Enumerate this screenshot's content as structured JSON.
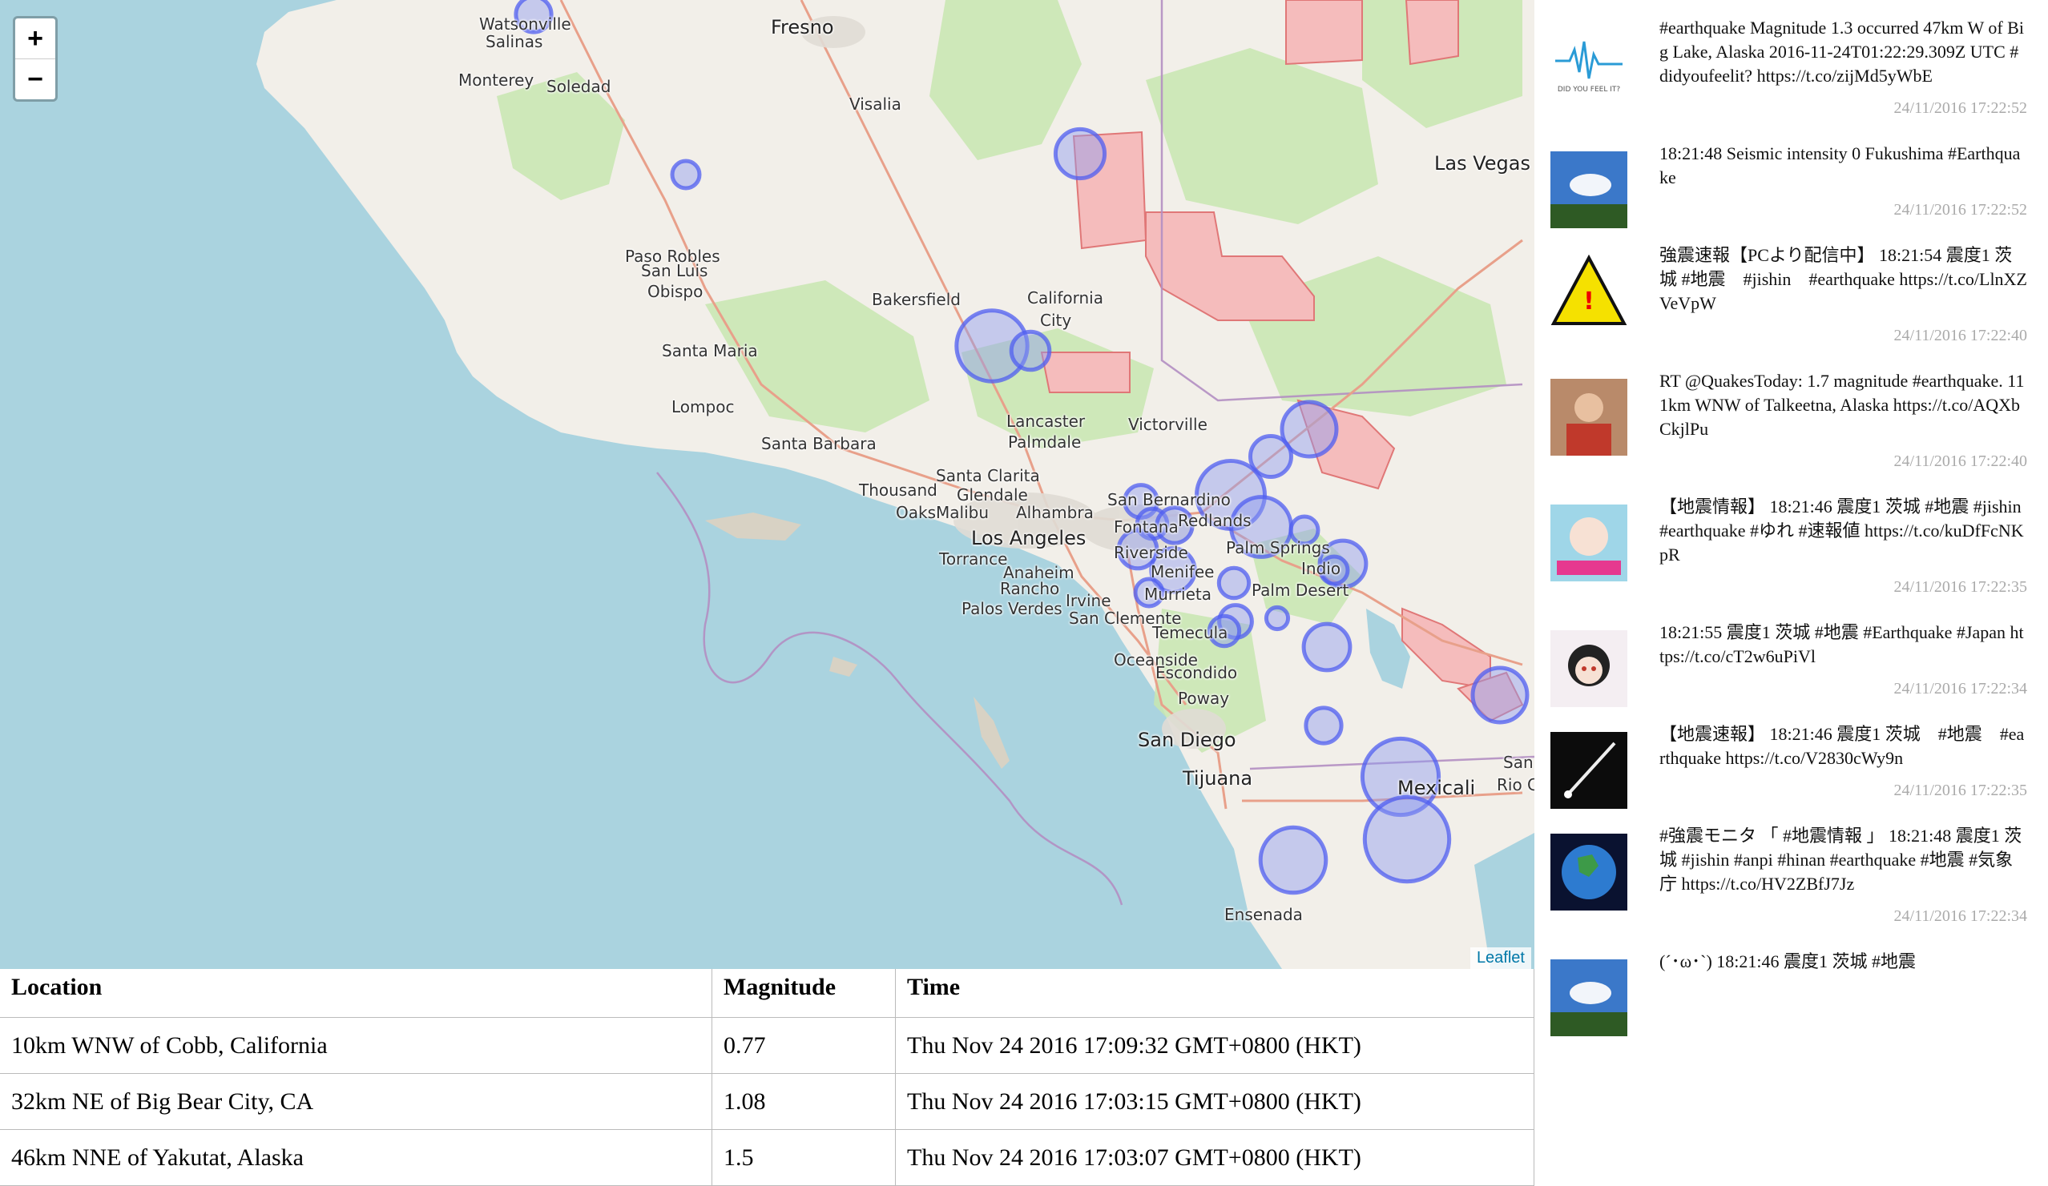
{
  "map": {
    "zoom_in": "+",
    "zoom_out": "−",
    "attribution": "Leaflet",
    "labels": [
      "Watsonville",
      "Salinas",
      "Monterey",
      "Soledad",
      "Fresno",
      "Visalia",
      "Paso Robles",
      "San Luis",
      "Obispo",
      "Bakersfield",
      "California",
      "City",
      "Santa Maria",
      "Lompoc",
      "Las Vegas",
      "Lancaster",
      "Palmdale",
      "Victorville",
      "Santa Barbara",
      "Santa Clarita",
      "Thousand",
      "Oaks",
      "Malibu",
      "Glendale",
      "Los Angeles",
      "Alhambra",
      "San Bernardino",
      "Fontana",
      "Redlands",
      "Torrance",
      "Anaheim",
      "Riverside",
      "Palm Springs",
      "Indio",
      "Menifee",
      "Rancho",
      "Palos Verdes",
      "Irvine",
      "Murrieta",
      "Palm Desert",
      "San Clemente",
      "Temecula",
      "Oceanside",
      "Escondido",
      "Poway",
      "San Diego",
      "Tijuana",
      "Mexicali",
      "San",
      "Rio Co",
      "Ensenada"
    ]
  },
  "quake_circles": [
    {
      "mag": 1.3
    },
    {
      "mag": 1.0
    },
    {
      "mag": 1.8
    },
    {
      "mag": 2.6
    },
    {
      "mag": 1.4
    },
    {
      "mag": 2.0
    },
    {
      "mag": 1.5
    },
    {
      "mag": 2.5
    },
    {
      "mag": 2.2
    },
    {
      "mag": 1.2
    },
    {
      "mag": 1.1
    },
    {
      "mag": 1.3
    },
    {
      "mag": 1.0
    },
    {
      "mag": 1.7
    },
    {
      "mag": 1.4
    },
    {
      "mag": 1.6
    },
    {
      "mag": 1.0
    },
    {
      "mag": 1.1
    },
    {
      "mag": 0.8
    },
    {
      "mag": 1.2
    },
    {
      "mag": 1.1
    },
    {
      "mag": 1.7
    },
    {
      "mag": 1.3
    },
    {
      "mag": 2.8
    },
    {
      "mag": 3.1
    },
    {
      "mag": 2.4
    },
    {
      "mag": 2.0
    },
    {
      "mag": 1.0
    }
  ],
  "table": {
    "headers": [
      "Location",
      "Magnitude",
      "Time"
    ],
    "rows": [
      [
        "10km WNW of Cobb, California",
        "0.77",
        "Thu Nov 24 2016 17:09:32 GMT+0800 (HKT)"
      ],
      [
        "32km NE of Big Bear City, CA",
        "1.08",
        "Thu Nov 24 2016 17:03:15 GMT+0800 (HKT)"
      ],
      [
        "46km NNE of Yakutat, Alaska",
        "1.5",
        "Thu Nov 24 2016 17:03:07 GMT+0800 (HKT)"
      ]
    ]
  },
  "tweets": [
    {
      "text": "#earthquake Magnitude 1.3 occurred 47km W of Big Lake, Alaska 2016-11-24T01:22:29.309Z UTC #didyoufeelit? https://t.co/zijMd5yWbE",
      "time": "24/11/2016 17:22:52",
      "avatar": "seismograph-logo",
      "avatar_label": "DID YOU FEEL IT?"
    },
    {
      "text": "18:21:48 Seismic intensity 0 Fukushima #Earthquake",
      "time": "24/11/2016 17:22:52",
      "avatar": "sky-photo"
    },
    {
      "text": "強震速報【PCより配信中】 18:21:54 震度1 茨城 #地震　#jishin　#earthquake https://t.co/LlnXZVeVpW",
      "time": "24/11/2016 17:22:40",
      "avatar": "warning-sign"
    },
    {
      "text": "RT @QuakesToday: 1.7 magnitude #earthquake. 111km WNW of Talkeetna, Alaska https://t.co/AQXbCkjlPu",
      "time": "24/11/2016 17:22:40",
      "avatar": "person-photo"
    },
    {
      "text": "【地震情報】 18:21:46 震度1 茨城 #地震 #jishin #earthquake #ゆれ #速報値 https://t.co/kuDfFcNKpR",
      "time": "24/11/2016 17:22:35",
      "avatar": "anime-avatar"
    },
    {
      "text": "18:21:55 震度1 茨城 #地震 #Earthquake #Japan https://t.co/cT2w6uPiVl",
      "time": "24/11/2016 17:22:34",
      "avatar": "anime-girl-avatar"
    },
    {
      "text": "【地震速報】 18:21:46 震度1 茨城　#地震　#earthquake https://t.co/V2830cWy9n",
      "time": "24/11/2016 17:22:35",
      "avatar": "meteor-avatar"
    },
    {
      "text": "#強震モニタ 「 #地震情報 」 18:21:48 震度1 茨城 #jishin #anpi #hinan #earthquake #地震 #気象庁 https://t.co/HV2ZBfJ7Jz",
      "time": "24/11/2016 17:22:34",
      "avatar": "earth-avatar"
    },
    {
      "text": "(´･ω･`) 18:21:46 震度1 茨城 #地震",
      "time": "",
      "avatar": "sky-photo"
    }
  ],
  "colors": {
    "quake_fill": "#8e9bef",
    "quake_stroke": "#4f5ef0",
    "water": "#aad3df",
    "land": "#f2efe9",
    "park": "#c8e6b0",
    "restricted": "#f2a0a0"
  }
}
